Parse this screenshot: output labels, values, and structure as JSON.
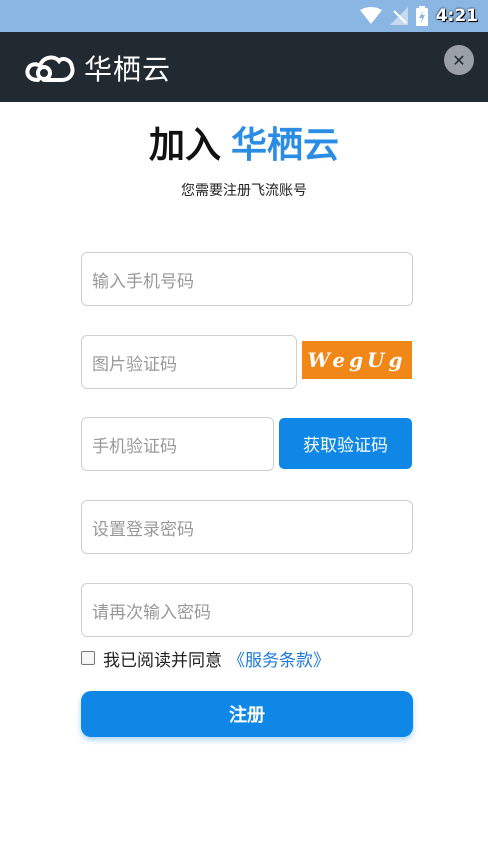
{
  "status_bar": {
    "time": "4:21",
    "icons": [
      "wifi-icon",
      "signal-icon",
      "battery-charging-icon"
    ]
  },
  "header": {
    "brand": "华栖云",
    "logo_icon": "cloud-logo-icon",
    "close_icon": "close-icon"
  },
  "title": {
    "prefix": "加入",
    "brand": "华栖云"
  },
  "subtitle": "您需要注册飞流账号",
  "form": {
    "phone_placeholder": "输入手机号码",
    "image_code_placeholder": "图片验证码",
    "captcha_text": "WegUg",
    "sms_code_placeholder": "手机验证码",
    "get_code_label": "获取验证码",
    "password_placeholder": "设置登录密码",
    "confirm_password_placeholder": "请再次输入密码",
    "agree_label": "我已阅读并同意",
    "terms_link": "《服务条款》",
    "agree_checked": false,
    "submit_label": "注册"
  },
  "colors": {
    "status_bar": "#8ab6e4",
    "header_bg": "#222a31",
    "accent": "#0f87e6",
    "brand_blue": "#2a8ce4",
    "captcha_bg": "#f08717"
  }
}
